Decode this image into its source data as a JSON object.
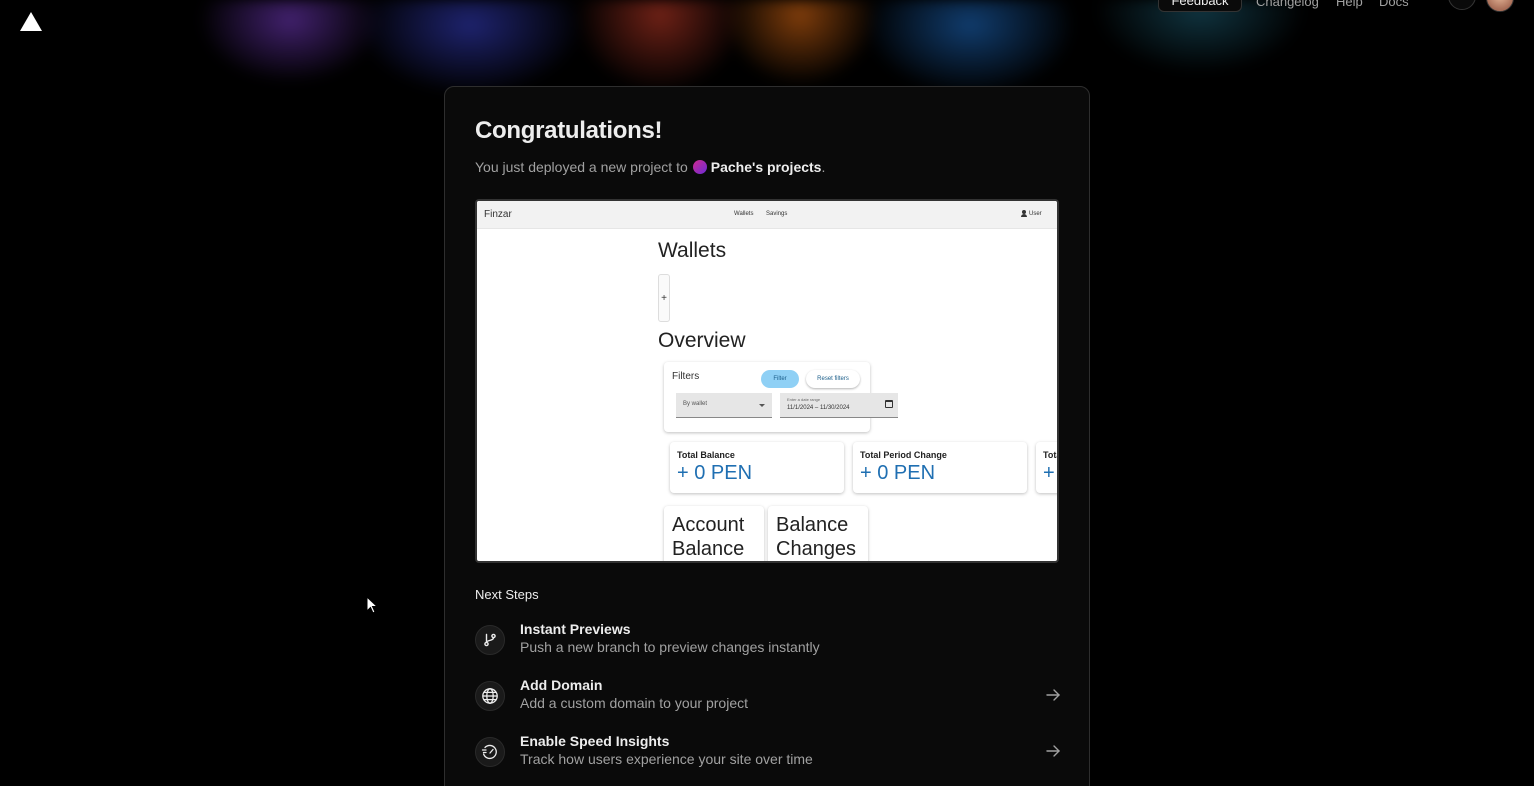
{
  "topbar": {
    "logo": "vercel-triangle-logo",
    "feedback_label": "Feedback",
    "links": [
      "Changelog",
      "Help",
      "Docs"
    ]
  },
  "card": {
    "title": "Congratulations!",
    "subtitle_prefix": "You just deployed a new project to",
    "team_name": "Pache's projects",
    "subtitle_suffix": "."
  },
  "preview": {
    "brand": "Finzar",
    "nav": [
      "Wallets",
      "Savings"
    ],
    "user_label": "User",
    "heading_wallets": "Wallets",
    "add_button": "+",
    "heading_overview": "Overview",
    "filters": {
      "label": "Filters",
      "filter_button": "Filter",
      "reset_button": "Reset filters",
      "wallet_select": "By wallet",
      "date_label": "Enter a date range",
      "date_start": "11/1/2024",
      "date_sep": "–",
      "date_end": "11/30/2024"
    },
    "stats": [
      {
        "label": "Total Balance",
        "value": "+ 0 PEN"
      },
      {
        "label": "Total Period Change",
        "value": "+ 0 PEN"
      },
      {
        "label": "Tota",
        "value": "+"
      }
    ],
    "charts": [
      "Account Balance",
      "Balance Changes"
    ]
  },
  "next_steps": {
    "label": "Next Steps",
    "items": [
      {
        "title": "Instant Previews",
        "desc": "Push a new branch to preview changes instantly",
        "icon": "git-branch-icon"
      },
      {
        "title": "Add Domain",
        "desc": "Add a custom domain to your project",
        "icon": "globe-icon"
      },
      {
        "title": "Enable Speed Insights",
        "desc": "Track how users experience your site over time",
        "icon": "speed-gauge-icon"
      }
    ]
  }
}
